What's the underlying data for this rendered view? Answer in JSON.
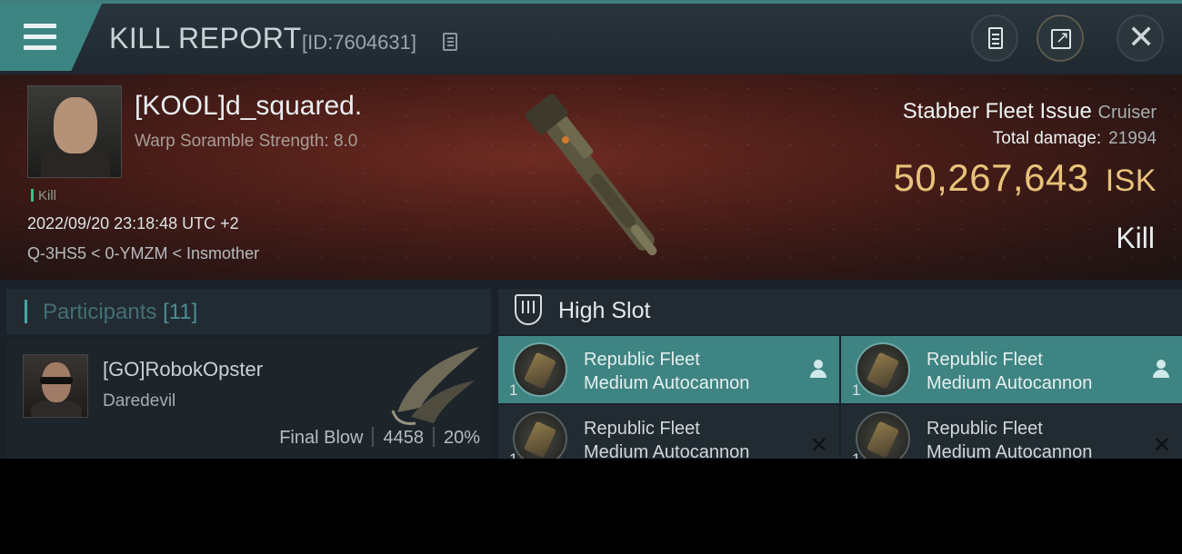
{
  "header": {
    "title": "KILL REPORT",
    "report_id": "[ID:7604631]"
  },
  "victim": {
    "name": "[KOOL]d_squared.",
    "warp_scramble": "Warp Soramble Strength: 8.0",
    "tag": "Kill",
    "timestamp": "2022/09/20 23:18:48 UTC +2",
    "location": "Q-3HS5 < 0-YMZM < Insmother",
    "ship": "Stabber Fleet Issue",
    "ship_class": "Cruiser",
    "total_damage_label": "Total damage:",
    "total_damage": "21994",
    "isk_value": "50,267,643",
    "isk_unit": "ISK",
    "result": "Kill"
  },
  "participants": {
    "title": "Participants",
    "count": "[11]",
    "items": [
      {
        "name": "[GO]RobokOpster",
        "ship": "Daredevil",
        "label": "Final Blow",
        "damage": "4458",
        "percent": "20%"
      }
    ]
  },
  "high_slot": {
    "title": "High Slot",
    "modules": [
      {
        "line1": "Republic Fleet",
        "line2": "Medium Autocannon",
        "qty": "1",
        "selected": true
      },
      {
        "line1": "Republic Fleet",
        "line2": "Medium Autocannon",
        "qty": "1",
        "selected": true
      },
      {
        "line1": "Republic Fleet",
        "line2": "Medium Autocannon",
        "qty": "1",
        "selected": false
      },
      {
        "line1": "Republic Fleet",
        "line2": "Medium Autocannon",
        "qty": "1",
        "selected": false
      }
    ]
  },
  "colors": {
    "accent": "#3e8482",
    "isk": "#e8c27a",
    "banner": "#4a1d18"
  }
}
